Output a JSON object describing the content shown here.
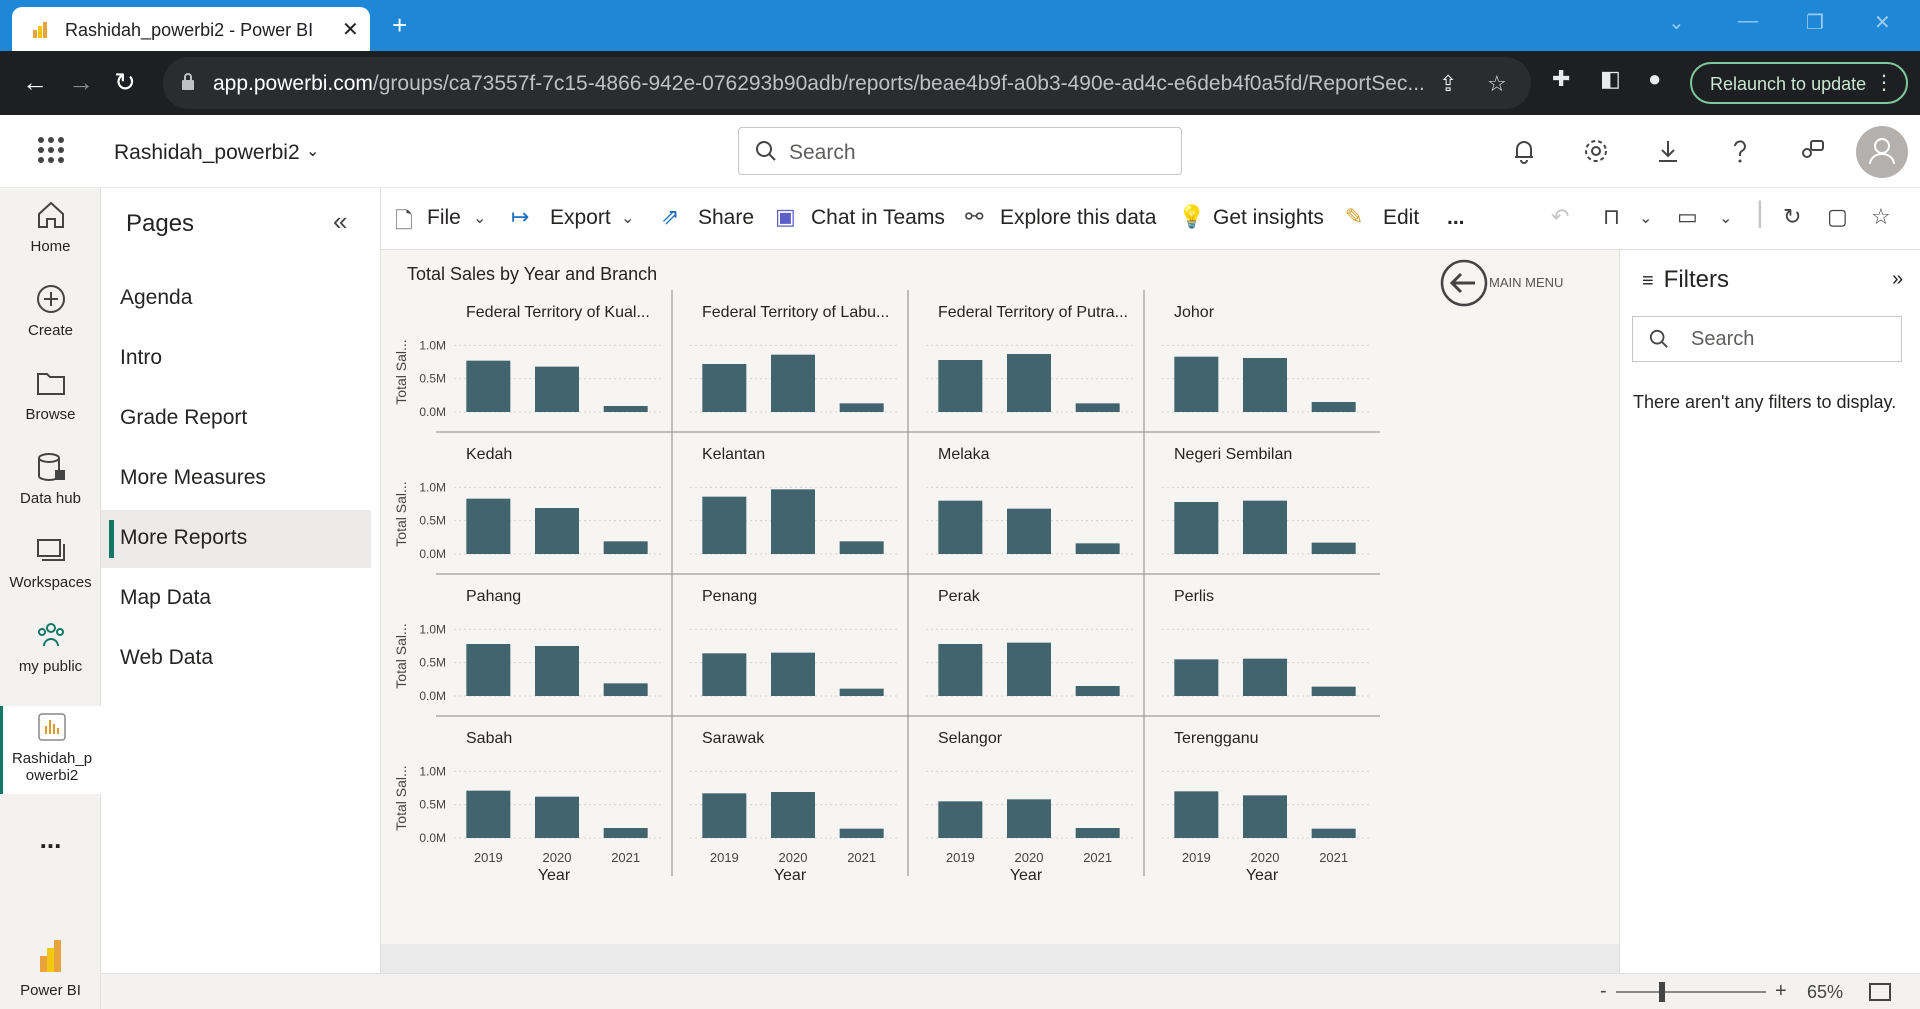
{
  "browser": {
    "tab_title": "Rashidah_powerbi2 - Power BI",
    "url_host": "app.powerbi.com",
    "url_path": "/groups/ca73557f-7c15-4866-942e-076293b90adb/reports/beae4b9f-a0b3-490e-ad4c-e6deb4f0a5fd/ReportSec...",
    "relaunch_label": "Relaunch to update"
  },
  "header": {
    "workspace_name": "Rashidah_powerbi2",
    "search_placeholder": "Search"
  },
  "leftnav": {
    "items": [
      {
        "label": "Home",
        "icon": "home-icon"
      },
      {
        "label": "Create",
        "icon": "plus-circle-icon"
      },
      {
        "label": "Browse",
        "icon": "folder-icon"
      },
      {
        "label": "Data hub",
        "icon": "database-icon"
      },
      {
        "label": "Workspaces",
        "icon": "workspaces-icon"
      },
      {
        "label": "my public",
        "icon": "people-icon"
      },
      {
        "label": "Rashidah_p owerbi2",
        "icon": "report-icon"
      }
    ],
    "more": "...",
    "brand": "Power BI"
  },
  "pages": {
    "title": "Pages",
    "items": [
      "Agenda",
      "Intro",
      "Grade Report",
      "More Measures",
      "More Reports",
      "Map Data",
      "Web Data"
    ],
    "active": "More Reports"
  },
  "toolbar": {
    "file": "File",
    "export": "Export",
    "share": "Share",
    "chat": "Chat in Teams",
    "explore": "Explore this data",
    "insights": "Get insights",
    "edit": "Edit",
    "more": "..."
  },
  "report": {
    "main_menu_label": "MAIN MENU"
  },
  "filters": {
    "title": "Filters",
    "search_placeholder": "Search",
    "empty_message": "There aren't any filters to display."
  },
  "status": {
    "zoom": "65%"
  },
  "colors": {
    "bar": "#41646f",
    "accent": "#117865",
    "browser_blue": "#1e88d6"
  },
  "chart_data": {
    "type": "bar",
    "title": "Total Sales by Year and Branch",
    "xlabel": "Year",
    "ylabel": "Total Sal...",
    "categories": [
      "2019",
      "2020",
      "2021"
    ],
    "yticks": [
      "0.0M",
      "0.5M",
      "1.0M"
    ],
    "ylim": [
      0,
      1200000
    ],
    "panels": [
      {
        "name": "Federal Territory of Kual...",
        "values": [
          770000,
          680000,
          90000
        ]
      },
      {
        "name": "Federal Territory of Labu...",
        "values": [
          720000,
          860000,
          130000
        ]
      },
      {
        "name": "Federal Territory of Putra...",
        "values": [
          780000,
          870000,
          130000
        ]
      },
      {
        "name": "Johor",
        "values": [
          830000,
          810000,
          150000
        ]
      },
      {
        "name": "Kedah",
        "values": [
          830000,
          690000,
          190000
        ]
      },
      {
        "name": "Kelantan",
        "values": [
          860000,
          970000,
          190000
        ]
      },
      {
        "name": "Melaka",
        "values": [
          800000,
          680000,
          160000
        ]
      },
      {
        "name": "Negeri Sembilan",
        "values": [
          780000,
          800000,
          170000
        ]
      },
      {
        "name": "Pahang",
        "values": [
          780000,
          750000,
          190000
        ]
      },
      {
        "name": "Penang",
        "values": [
          640000,
          650000,
          110000
        ]
      },
      {
        "name": "Perak",
        "values": [
          780000,
          800000,
          150000
        ]
      },
      {
        "name": "Perlis",
        "values": [
          550000,
          560000,
          140000
        ]
      },
      {
        "name": "Sabah",
        "values": [
          710000,
          620000,
          150000
        ]
      },
      {
        "name": "Sarawak",
        "values": [
          670000,
          690000,
          140000
        ]
      },
      {
        "name": "Selangor",
        "values": [
          550000,
          580000,
          150000
        ]
      },
      {
        "name": "Terengganu",
        "values": [
          700000,
          640000,
          140000
        ]
      }
    ]
  }
}
